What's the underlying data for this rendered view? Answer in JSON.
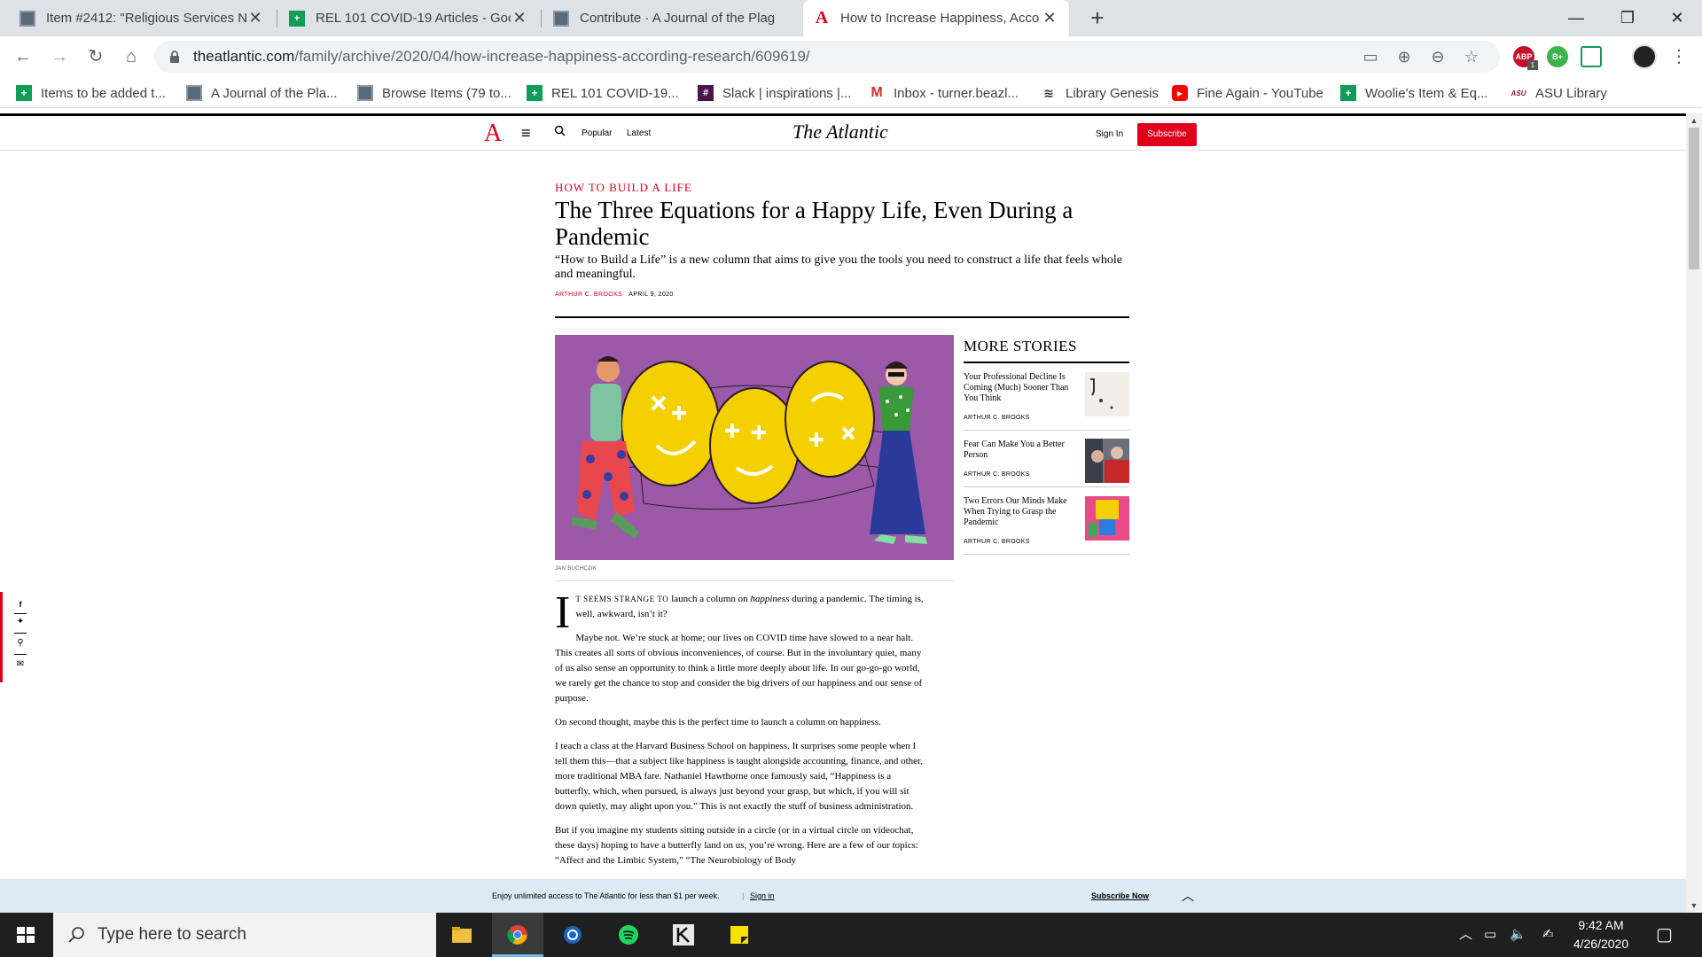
{
  "browser": {
    "tabs": [
      {
        "title": "Item #2412: \"Religious Services N",
        "icon": "omeka-icon",
        "active": false
      },
      {
        "title": "REL 101 COVID-19 Articles - Goo",
        "icon": "sheets-icon",
        "active": false
      },
      {
        "title": "Contribute · A Journal of the Plag",
        "icon": "omeka-icon",
        "active": false
      },
      {
        "title": "How to Increase Happiness, Acco",
        "icon": "atlantic-icon",
        "active": true
      }
    ],
    "new_tab": "+",
    "url_host": "theatlantic.com",
    "url_path": "/family/archive/2020/04/how-increase-happiness-according-research/609619/",
    "extensions": [
      {
        "label": "ABP",
        "badge": "1",
        "color": "#c70d2c"
      },
      {
        "label": "B+",
        "color": "#3cb44a"
      },
      {
        "label": "",
        "color": "#ffffff"
      }
    ]
  },
  "bookmarks": [
    {
      "label": "Items to be added t...",
      "icon": "sheets-icon"
    },
    {
      "label": "A Journal of the Pla...",
      "icon": "omeka-icon"
    },
    {
      "label": "Browse Items (79 to...",
      "icon": "omeka-icon"
    },
    {
      "label": "REL 101 COVID-19...",
      "icon": "sheets-icon"
    },
    {
      "label": "Slack | inspirations |...",
      "icon": "slack-icon"
    },
    {
      "label": "Inbox - turner.beazl...",
      "icon": "gmail-icon"
    },
    {
      "label": "Library Genesis",
      "icon": "libgen-icon"
    },
    {
      "label": "Fine Again - YouTube",
      "icon": "youtube-icon"
    },
    {
      "label": "Woolie's Item & Eq...",
      "icon": "sheets-icon"
    },
    {
      "label": "ASU Library",
      "icon": "asu-icon"
    }
  ],
  "site": {
    "logo_letter": "A",
    "nav_popular": "Popular",
    "nav_latest": "Latest",
    "wordmark": "The Atlantic",
    "sign_in": "Sign In",
    "subscribe": "Subscribe"
  },
  "article": {
    "kicker": "HOW TO BUILD A LIFE",
    "headline": "The Three Equations for a Happy Life, Even During a Pandemic",
    "dek": "“How to Build a Life” is a new column that aims to give you the tools you need to construct a life that feels whole and meaningful.",
    "author": "ARTHUR C. BROOKS",
    "date": "APRIL 9, 2020",
    "image_credit": "JAN BUCHCZIK",
    "dropcap": "I",
    "lead_smallcaps": "t seems strange to",
    "lead_rest_1": " launch a column on ",
    "lead_italic": "happiness",
    "lead_rest_2": " during a pandemic. The timing is, well, awkward, isn’t it?",
    "paragraphs": [
      "Maybe not. We’re stuck at home; our lives on COVID time have slowed to a near halt. This creates all sorts of obvious inconveniences, of course. But in the involuntary quiet, many of us also sense an opportunity to think a little more deeply about life. In our go-go-go world, we rarely get the chance to stop and consider the big drivers of our happiness and our sense of purpose.",
      "On second thought, maybe this is the perfect time to launch a column on happiness.",
      "I teach a class at the Harvard Business School on happiness. It surprises some people when I tell them this—that a subject like happiness is taught alongside accounting, finance, and other, more traditional MBA fare. Nathaniel Hawthorne once famously said, “Happiness is a butterfly, which, when pursued, is always just beyond your grasp, but which, if you will sit down quietly, may alight upon you.” This is not exactly the stuff of business administration.",
      "But if you imagine my students sitting outside in a circle (or in a virtual circle on videochat, these days) hoping to have a butterfly land on us, you’re wrong. Here are a few of our topics: “Affect and the Limbic System,” “The Neurobiology of Body"
    ]
  },
  "more_stories": {
    "heading": "MORE STORIES",
    "items": [
      {
        "title": "Your Professional Decline Is Coming (Much) Sooner Than You Think",
        "author": "ARTHUR C. BROOKS"
      },
      {
        "title": "Fear Can Make You a Better Person",
        "author": "ARTHUR C. BROOKS"
      },
      {
        "title": "Two Errors Our Minds Make When Trying to Grasp the Pandemic",
        "author": "ARTHUR C. BROOKS"
      }
    ]
  },
  "paywall": {
    "text": "Enjoy unlimited access to The Atlantic for less than $1 per week.",
    "separator": "|",
    "sign_in": "Sign in",
    "subscribe": "Subscribe Now"
  },
  "taskbar": {
    "search_placeholder": "Type here to search",
    "time": "9:42 AM",
    "date": "4/26/2020"
  },
  "colors": {
    "atlantic_red": "#e0001b",
    "hero_purple": "#9b59a8",
    "paywall_blue": "#dbeaf5"
  }
}
